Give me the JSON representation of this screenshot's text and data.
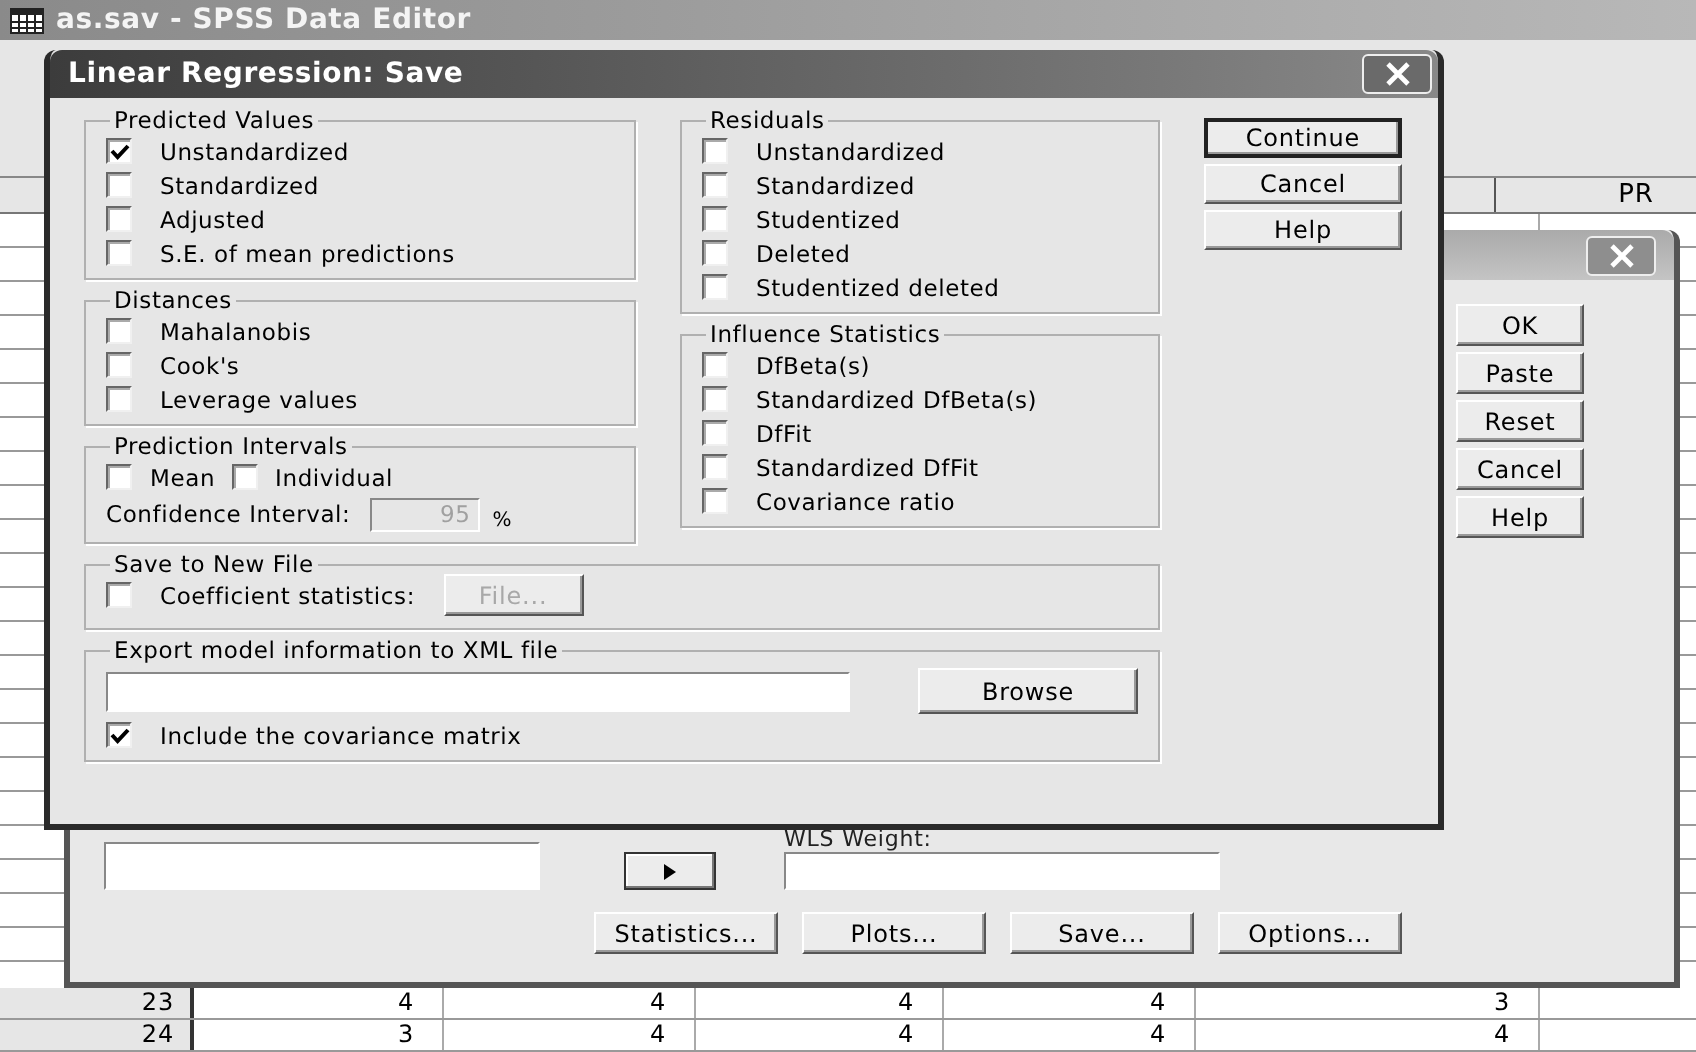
{
  "data_editor": {
    "title": "as.sav - SPSS Data Editor",
    "column_header": "PR",
    "rows": [
      {
        "row": "23",
        "cells": [
          "4",
          "4",
          "4",
          "4",
          "3"
        ]
      },
      {
        "row": "24",
        "cells": [
          "3",
          "4",
          "4",
          "4",
          "4"
        ]
      }
    ]
  },
  "regression_dialog": {
    "buttons": [
      "OK",
      "Paste",
      "Reset",
      "Cancel",
      "Help"
    ],
    "wls_label": "WLS Weight:",
    "bottom_buttons": [
      "Statistics...",
      "Plots...",
      "Save...",
      "Options..."
    ]
  },
  "save_dialog": {
    "title": "Linear Regression: Save",
    "left_groups": [
      {
        "kind": "checklist",
        "title": "Predicted Values",
        "items": [
          {
            "label": "Unstandardized",
            "checked": true
          },
          {
            "label": "Standardized",
            "checked": false
          },
          {
            "label": "Adjusted",
            "checked": false
          },
          {
            "label": "S.E. of mean predictions",
            "checked": false
          }
        ]
      },
      {
        "kind": "checklist",
        "title": "Distances",
        "items": [
          {
            "label": "Mahalanobis",
            "checked": false
          },
          {
            "label": "Cook's",
            "checked": false
          },
          {
            "label": "Leverage values",
            "checked": false
          }
        ]
      },
      {
        "kind": "intervals",
        "title": "Prediction Intervals",
        "items": [
          {
            "label": "Mean",
            "checked": false
          },
          {
            "label": "Individual",
            "checked": false
          }
        ],
        "confidence_label": "Confidence Interval:",
        "confidence_value": "95",
        "unit": "%",
        "disabled": true
      }
    ],
    "middle_groups": [
      {
        "kind": "checklist",
        "title": "Residuals",
        "items": [
          {
            "label": "Unstandardized",
            "checked": false
          },
          {
            "label": "Standardized",
            "checked": false
          },
          {
            "label": "Studentized",
            "checked": false
          },
          {
            "label": "Deleted",
            "checked": false
          },
          {
            "label": "Studentized deleted",
            "checked": false
          }
        ]
      },
      {
        "kind": "checklist",
        "title": "Influence Statistics",
        "items": [
          {
            "label": "DfBeta(s)",
            "checked": false
          },
          {
            "label": "Standardized DfBeta(s)",
            "checked": false
          },
          {
            "label": "DfFit",
            "checked": false
          },
          {
            "label": "Standardized DfFit",
            "checked": false
          },
          {
            "label": "Covariance ratio",
            "checked": false
          }
        ]
      }
    ],
    "bottom_groups": [
      {
        "kind": "newfile",
        "title": "Save to New File",
        "items": [
          {
            "label": "Coefficient statistics:",
            "checked": false
          }
        ],
        "button": "File...",
        "disabled": true
      },
      {
        "kind": "export",
        "title": "Export model information to XML file",
        "button": "Browse",
        "items": [
          {
            "label": "Include the covariance matrix",
            "checked": true
          }
        ]
      }
    ],
    "buttons": [
      {
        "label": "Continue",
        "default": true
      },
      {
        "label": "Cancel",
        "default": false
      },
      {
        "label": "Help",
        "default": false
      }
    ]
  }
}
